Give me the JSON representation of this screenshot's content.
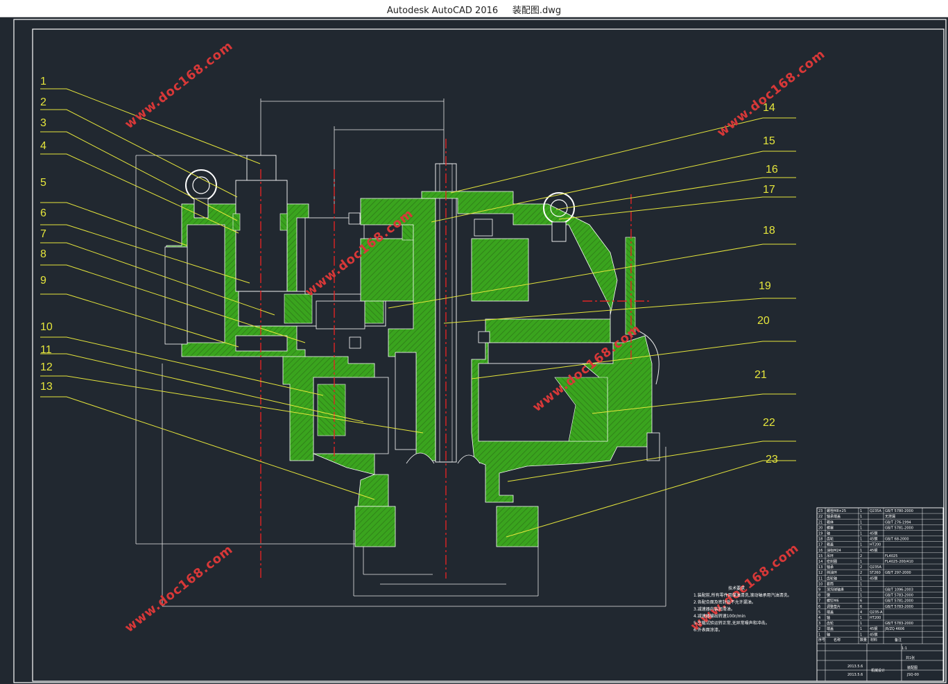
{
  "window": {
    "app_title": "Autodesk AutoCAD 2016",
    "file_name": "装配图.dwg"
  },
  "colors": {
    "background": "#212830",
    "frame": "#ffffff",
    "hatch": "#4cbf2c",
    "leader": "#e6e63c",
    "centerline": "#e02424",
    "watermark": "#d83838"
  },
  "callouts_left": [
    "1",
    "2",
    "3",
    "4",
    "5",
    "6",
    "7",
    "8",
    "9",
    "10",
    "11",
    "12",
    "13"
  ],
  "callouts_right": [
    "14",
    "15",
    "16",
    "17",
    "18",
    "19",
    "20",
    "21",
    "22",
    "23"
  ],
  "watermark_text": "www.doc168.com",
  "notes": {
    "heading": "技术要求",
    "lines": [
      "1.装配前,所有零件用煤油清洗,滚动轴承用汽油清洗。",
      "2.各配合面及密封处不允许漏油。",
      "3.减速器内装润滑油。",
      "4.减速器输出转速100r/min",
      "5.空载试验运转正常,无异常噪声和冲击。",
      "6.外表面涂漆。"
    ]
  },
  "bom": {
    "rows": [
      {
        "no": "23",
        "name": "螺栓M8×25",
        "qty": "1",
        "mat": "Q235A",
        "std": "GB/T 5780-2000"
      },
      {
        "no": "22",
        "name": "轴承端盖",
        "qty": "1",
        "mat": "",
        "std": "无泄漏"
      },
      {
        "no": "21",
        "name": "箱体",
        "qty": "1",
        "mat": "",
        "std": "GB/T 276-1994"
      },
      {
        "no": "20",
        "name": "螺塞",
        "qty": "1",
        "mat": "",
        "std": "GB/T 5781-2000"
      },
      {
        "no": "19",
        "name": "轴",
        "qty": "1",
        "mat": "45钢",
        "std": ""
      },
      {
        "no": "18",
        "name": "齿轮",
        "qty": "1",
        "mat": "45钢",
        "std": "GB/T 68-2000"
      },
      {
        "no": "17",
        "name": "箱盖",
        "qty": "1",
        "mat": "HT200",
        "std": ""
      },
      {
        "no": "16",
        "name": "油标M24",
        "qty": "1",
        "mat": "45钢",
        "std": ""
      },
      {
        "no": "15",
        "name": "吊环",
        "qty": "2",
        "mat": "",
        "std": "FL4025"
      },
      {
        "no": "14",
        "name": "密封圈",
        "qty": "1",
        "mat": "",
        "std": "FL4025-200/410"
      },
      {
        "no": "13",
        "name": "轴承",
        "qty": "2",
        "mat": "Q235A",
        "std": ""
      },
      {
        "no": "12",
        "name": "挡油环",
        "qty": "2",
        "mat": "ST260",
        "std": "GB/T 297-2000"
      },
      {
        "no": "11",
        "name": "齿轮轴",
        "qty": "1",
        "mat": "45钢",
        "std": ""
      },
      {
        "no": "10",
        "name": "套筒",
        "qty": "1",
        "mat": "",
        "std": ""
      },
      {
        "no": "9",
        "name": "深沟球轴承",
        "qty": "1",
        "mat": "",
        "std": "GB/T 1096-2003"
      },
      {
        "no": "8",
        "name": "键",
        "qty": "1",
        "mat": "",
        "std": "GB/T 5783-2000"
      },
      {
        "no": "7",
        "name": "螺钉M6",
        "qty": "6",
        "mat": "",
        "std": "GB/T 5781-2000"
      },
      {
        "no": "6",
        "name": "调整垫片",
        "qty": "6",
        "mat": "",
        "std": "GB/T 5783-2000"
      },
      {
        "no": "5",
        "name": "端盖",
        "qty": "4",
        "mat": "Q235-A",
        "std": ""
      },
      {
        "no": "4",
        "name": "轴",
        "qty": "1",
        "mat": "HT200",
        "std": ""
      },
      {
        "no": "3",
        "name": "齿轮",
        "qty": "1",
        "mat": "",
        "std": "GB/T 5783-2000"
      },
      {
        "no": "2",
        "name": "端盖",
        "qty": "1",
        "mat": "45钢",
        "std": "JB/ZQ 4606"
      },
      {
        "no": "1",
        "name": "轴",
        "qty": "1",
        "mat": "45钢",
        "std": ""
      }
    ],
    "header": {
      "no": "序号",
      "name": "名称",
      "qty": "数量",
      "mat": "材料",
      "std": "备注"
    },
    "title_block": {
      "drawing_name": "装配图",
      "scale": "1:1",
      "sheet": "共1张",
      "date1": "2013.5.6",
      "date2": "2013.5.6",
      "school": "机械设计",
      "code": "JSQ-00"
    }
  }
}
